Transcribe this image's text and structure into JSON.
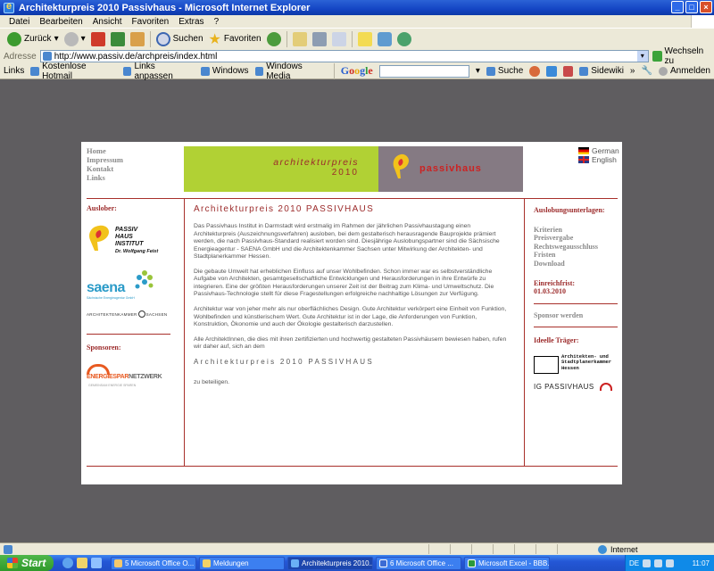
{
  "window": {
    "title": "Architekturpreis 2010 Passivhaus - Microsoft Internet Explorer"
  },
  "menu": [
    "Datei",
    "Bearbeiten",
    "Ansicht",
    "Favoriten",
    "Extras",
    "?"
  ],
  "toolbar": {
    "back_label": "Zurück",
    "search_label": "Suchen",
    "favorites_label": "Favoriten"
  },
  "address": {
    "label": "Adresse",
    "url": "http://www.passiv.de/archpreis/index.html",
    "go_label": "Wechseln zu"
  },
  "links_bar": {
    "label": "Links",
    "items": [
      "Kostenlose Hotmail",
      "Links anpassen",
      "Windows",
      "Windows Media"
    ],
    "google": {
      "search_label": "Suche",
      "sidewiki_label": "Sidewiki",
      "signin_label": "Anmelden"
    }
  },
  "site": {
    "nav": [
      "Home",
      "Impressum",
      "Kontakt",
      "Links"
    ],
    "banner": {
      "line1": "architekturpreis",
      "line2": "2010",
      "logo_text": "passivhaus"
    },
    "languages": [
      "German",
      "English"
    ],
    "left": {
      "organizer_head": "Auslober:",
      "phi_logo": [
        "PASSIV",
        "HAUS",
        "INSTITUT",
        "Dr. Wolfgang Feist"
      ],
      "saena_word": "saena",
      "saena_sub": "Sächsische Energieagentur GmbH",
      "akh_logo": [
        "ARCHITEKTENKAMMER",
        "SACHSEN"
      ],
      "sponsors_head": "Sponsoren:",
      "ens_logo": {
        "word_a": "ENERGIESPAR",
        "word_b": "NETZWERK",
        "tag": "GEMEINSAM ENERGIE SPAREN"
      }
    },
    "main": {
      "title": "Architekturpreis 2010 PASSIVHAUS",
      "paragraphs": [
        "Das Passivhaus Institut in Darmstadt wird erstmalig im Rahmen der jährlichen Passivhaustagung einen Architekturpreis (Auszeichnungsverfahren) ausloben, bei dem gestalterisch herausragende Bauprojekte prämiert werden, die nach Passivhaus-Standard realisiert worden sind. Diesjährige Auslobungspartner sind die Sächsische Energieagentur - SAENA GmbH und die Architektenkammer Sachsen unter Mitwirkung der Architekten- und Stadtplanerkammer Hessen.",
        "Die gebaute Umwelt hat erheblichen Einfluss auf unser Wohlbefinden. Schon immer war es selbstverständliche Aufgabe von Architekten, gesamtgesellschaftliche Entwicklungen und Herausforderungen in ihre Entwürfe zu integrieren. Eine der größten Herausforderungen unserer Zeit ist der Beitrag zum Klima- und Umweltschutz. Die Passivhaus-Technologie stellt für diese Fragestellungen erfolgreiche nachhaltige Lösungen zur Verfügung.",
        "Architektur war von jeher mehr als nur oberflächliches Design. Gute Architektur verkörpert eine Einheit von Funktion, Wohlbefinden und künstlerischem Wert. Gute Architektur ist in der Lage, die Anforderungen von Funktion, Konstruktion, Ökonomie und auch der Ökologie gestalterisch darzustellen.",
        "Alle ArchitektInnen, die dies mit ihren zertifizierten und hochwertig gestalteten Passivhäusern bewiesen haben, rufen wir daher auf, sich an dem"
      ],
      "closing_title": "Architekturpreis 2010 PASSIVHAUS",
      "closing_line": "zu beteiligen."
    },
    "right": {
      "docs_head": "Auslobungsunterlagen:",
      "doc_links": [
        "Kriterien",
        "Preisvergabe",
        "Rechtswegausschluss",
        "Fristen",
        "Download"
      ],
      "deadline_label": "Einreichfrist:",
      "deadline_date": "01.03.2010",
      "sponsor_link": "Sponsor werden",
      "supporters_head": "Ideelle Träger:",
      "akh_hessen": [
        "Architekten- und",
        "Stadtplanerkammer",
        "Hessen"
      ],
      "igp": "IG PASSIVHAUS"
    }
  },
  "status": {
    "zone": "Internet"
  },
  "taskbar": {
    "start": "Start",
    "tasks": [
      "5 Microsoft Office O...",
      "Meldungen",
      "Architekturpreis 2010...",
      "6 Microsoft Office ...",
      "Microsoft Excel - BBB..."
    ],
    "lang": "DE",
    "clock": "11:07"
  },
  "colors": {
    "accent_red": "#9c2b2b",
    "banner_green": "#b1d134",
    "banner_gray": "#857a83",
    "desktop_gray": "#5f5d60"
  }
}
